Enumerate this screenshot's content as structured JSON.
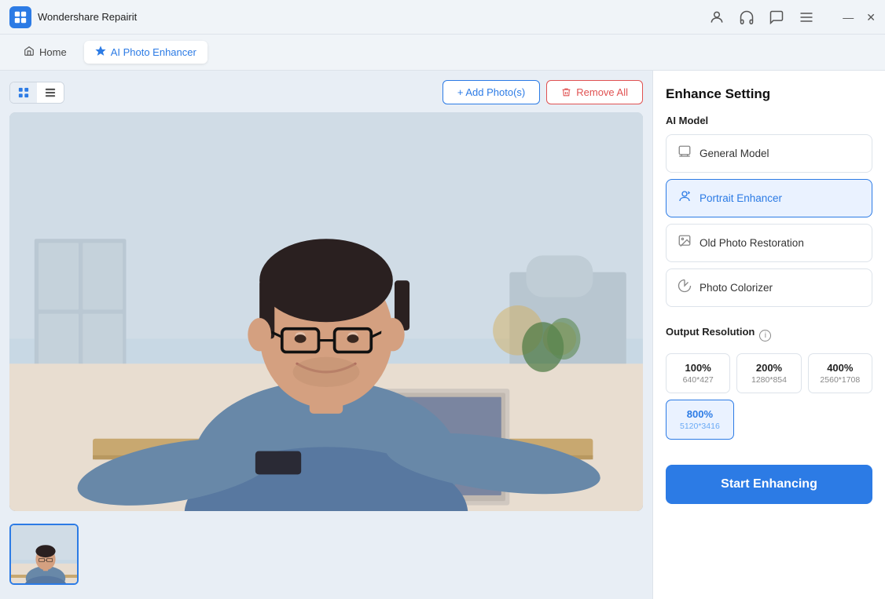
{
  "titlebar": {
    "app_name": "Wondershare Repairit",
    "icons": [
      "account-icon",
      "headphone-icon",
      "chat-icon",
      "menu-icon"
    ],
    "min_label": "−",
    "close_label": "✕"
  },
  "navbar": {
    "home_tab": "Home",
    "active_tab": "AI Photo Enhancer"
  },
  "toolbar": {
    "add_photos_label": "+ Add Photo(s)",
    "remove_all_label": "Remove All"
  },
  "right_panel": {
    "title": "Enhance Setting",
    "ai_model_label": "AI Model",
    "models": [
      {
        "id": "general",
        "label": "General Model",
        "selected": false
      },
      {
        "id": "portrait",
        "label": "Portrait Enhancer",
        "selected": true
      },
      {
        "id": "old_photo",
        "label": "Old Photo Restoration",
        "selected": false
      },
      {
        "id": "colorizer",
        "label": "Photo Colorizer",
        "selected": false
      }
    ],
    "output_resolution_label": "Output Resolution",
    "resolutions": [
      {
        "id": "100",
        "percent": "100%",
        "dim": "640*427",
        "selected": false
      },
      {
        "id": "200",
        "percent": "200%",
        "dim": "1280*854",
        "selected": false
      },
      {
        "id": "400",
        "percent": "400%",
        "dim": "2560*1708",
        "selected": false
      },
      {
        "id": "800",
        "percent": "800%",
        "dim": "5120*3416",
        "selected": true
      }
    ],
    "start_button_label": "Start Enhancing"
  }
}
